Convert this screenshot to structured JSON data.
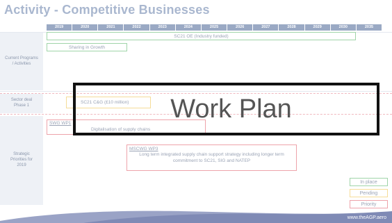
{
  "title": "Activity - Competitive Businesses",
  "years": [
    "2019",
    "2020",
    "2021",
    "2022",
    "2023",
    "2024",
    "2025",
    "2026",
    "2027",
    "2028",
    "2029",
    "2030",
    "2035"
  ],
  "rows": {
    "current": "Current Programs / Activities",
    "sector": "Sector deal Phase 1",
    "strategic": "Strategic Priorities for 2019"
  },
  "bars": {
    "sc21_oe": "SC21 OE (Industry funded)",
    "sharing": "Sharing in Growth",
    "sc21_cg": "SC21 C&G (£10 million)",
    "swg_wp1": "SWG WP1",
    "digitalisation": "Digitalisation of supply chains",
    "mscwg_title": "MSCWG WP3",
    "mscwg_body": "Long term integrated supply chain support strategy including longer term commitment to SC21, SIG and NATEP"
  },
  "legend": {
    "in_place": "In place",
    "pending": "Pending",
    "priority": "Priority"
  },
  "overlay_text": "Work Plan",
  "footer": "www.theAGP.aero",
  "colors": {
    "in_place": "#9fd4a8",
    "pending": "#f5dc98",
    "priority": "#eea3aa",
    "header": "#9aa9c4",
    "footer_wave": "#9aa3c6"
  }
}
